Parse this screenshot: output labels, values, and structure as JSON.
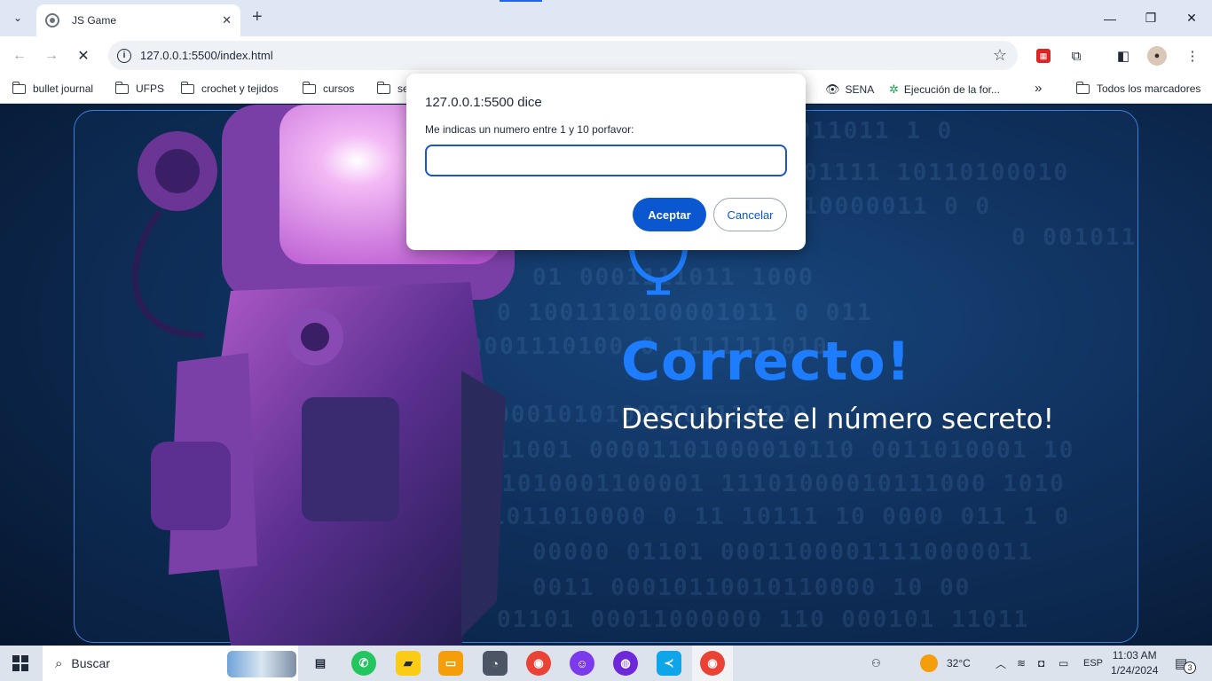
{
  "browser": {
    "tab_title": "JS Game",
    "url": "127.0.0.1:5500/index.html",
    "bookmarks": [
      {
        "label": "bullet journal",
        "icon": "folder-icon"
      },
      {
        "label": "UFPS",
        "icon": "folder-icon"
      },
      {
        "label": "crochet y tejidos",
        "icon": "folder-icon"
      },
      {
        "label": "cursos",
        "icon": "folder-icon"
      },
      {
        "label": "se",
        "icon": "folder-icon"
      },
      {
        "label": "SENA",
        "icon": "eye-icon"
      },
      {
        "label": "Ejecución de la for...",
        "icon": "sena-logo-icon"
      }
    ],
    "all_bookmarks": "Todos los marcadores",
    "overflow_glyph": "»"
  },
  "dialog": {
    "title": "127.0.0.1:5500 dice",
    "message": "Me indicas un numero entre 1 y 10 porfavor:",
    "input_value": "",
    "ok_label": "Aceptar",
    "cancel_label": "Cancelar"
  },
  "page": {
    "headline": "Correcto!",
    "subline": "Descubriste el número secreto!",
    "accent_color": "#1e7cff",
    "binary_rows": [
      "0011011 1 0",
      "01111  10110100010",
      "0110000011 0 0",
      "0 001011",
      "01  0001111011 1000",
      "0 1001110100001011 0 011",
      "00001110100 0 1111111010",
      "11 0100010101000101110100",
      "0001 11001 00001101000010110 0011010001 10",
      "011010001100001 11101000010111000 1010",
      "0001011010000 0 11 10111 10 0000 011 1 0",
      "00000 01101 00011000011110000011",
      "0011 00010110010110000 10 00",
      "01101 00011000000 110 000101 11011"
    ]
  },
  "taskbar": {
    "search_label": "Buscar",
    "weather": "32°C",
    "language": "ESP",
    "time": "11:03 AM",
    "date": "1/24/2024",
    "notification_count": "3",
    "apps": [
      "task-view-icon",
      "whatsapp-icon",
      "sticky-notes-icon",
      "file-explorer-icon",
      "clock-app-icon",
      "chrome-icon",
      "discord-icon",
      "github-icon",
      "vscode-icon",
      "chrome-profile-icon"
    ]
  }
}
